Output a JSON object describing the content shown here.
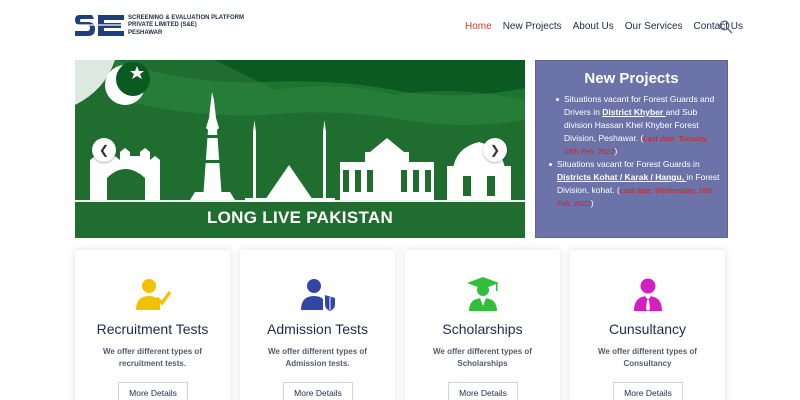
{
  "header": {
    "logo_mark": "SE",
    "logo_lines": [
      "SCREENING & EVALUATION PLATFORM",
      "PRIVATE LIMITED (S&E)",
      "PESHAWAR"
    ],
    "nav": [
      {
        "label": "Home",
        "active": true
      },
      {
        "label": "New Projects",
        "active": false
      },
      {
        "label": "About Us",
        "active": false
      },
      {
        "label": "Our Services",
        "active": false
      },
      {
        "label": "Contact Us",
        "active": false
      }
    ]
  },
  "banner": {
    "caption": "LONG LIVE  PAKISTAN",
    "prev_icon": "chevron-left-icon",
    "next_icon": "chevron-right-icon"
  },
  "projects": {
    "title": "New Projects",
    "items": [
      {
        "pre": "Situations vacant for Forest Guards and Drivers in ",
        "link": "District Khyber ",
        "post": "and Sub division Hassan Khel Khyber Forest Division, Peshawar. (",
        "deadline": "Last date: Tuesday, 15th Feb, 2022",
        "close": ")"
      },
      {
        "pre": "Situations vacant for Forest Guards in ",
        "link": "Districts Kohat / Karak / Hangu, ",
        "post": " in Forest Division, kohat. (",
        "deadline": "Last date: Wednesday, 16th Feb, 2022",
        "close": ")"
      }
    ]
  },
  "cards": [
    {
      "title": "Recruitment Tests",
      "desc": "We offer different types of recruitment tests.",
      "button": "More Details",
      "icon": "user-check-icon",
      "color": "#f2c200"
    },
    {
      "title": "Admission Tests",
      "desc": "We offer different types of Admission tests.",
      "button": "More Details",
      "icon": "user-shield-icon",
      "color": "#3346a8"
    },
    {
      "title": "Scholarships",
      "desc": "We offer different types of Scholarships",
      "button": "More Details",
      "icon": "graduate-icon",
      "color": "#2fbf3a"
    },
    {
      "title": "Cunsultancy",
      "desc": "We offer different types of Consultancy",
      "button": "More Details",
      "icon": "consultant-icon",
      "color": "#d21fc1"
    }
  ],
  "colors": {
    "nav_active": "#d33a2c",
    "banner_green": "#1f6d2f",
    "panel_bg": "#6c73a8",
    "deadline_red": "#e01b1b"
  }
}
